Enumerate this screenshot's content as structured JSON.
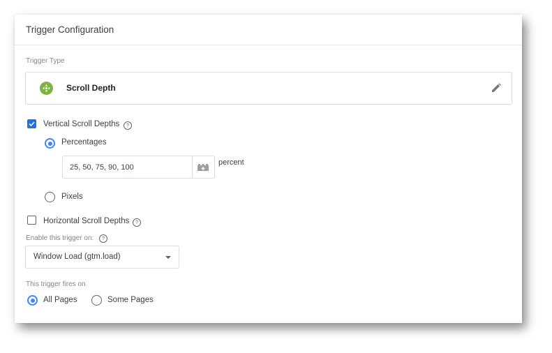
{
  "header": {
    "title": "Trigger Configuration"
  },
  "trigger_type": {
    "label": "Trigger Type",
    "name": "Scroll Depth",
    "icon": "scroll-depth-icon",
    "icon_color": "#7cb342",
    "edit_icon": "pencil-icon"
  },
  "vertical": {
    "label": "Vertical Scroll Depths",
    "checked": true,
    "help": "?",
    "options": [
      {
        "label": "Percentages",
        "selected": true
      },
      {
        "label": "Pixels",
        "selected": false
      }
    ],
    "value": "25, 50, 75, 90, 100",
    "unit": "percent",
    "variable_icon": "variable-brick-icon"
  },
  "horizontal": {
    "label": "Horizontal Scroll Depths",
    "checked": false,
    "help": "?"
  },
  "enable_on": {
    "label": "Enable this trigger on:",
    "help": "?",
    "selected": "Window Load (gtm.load)"
  },
  "fires_on": {
    "label": "This trigger fires on",
    "options": [
      {
        "label": "All Pages",
        "selected": true
      },
      {
        "label": "Some Pages",
        "selected": false
      }
    ]
  },
  "colors": {
    "accent": "#4285f4",
    "checkbox": "#1a73e8"
  }
}
